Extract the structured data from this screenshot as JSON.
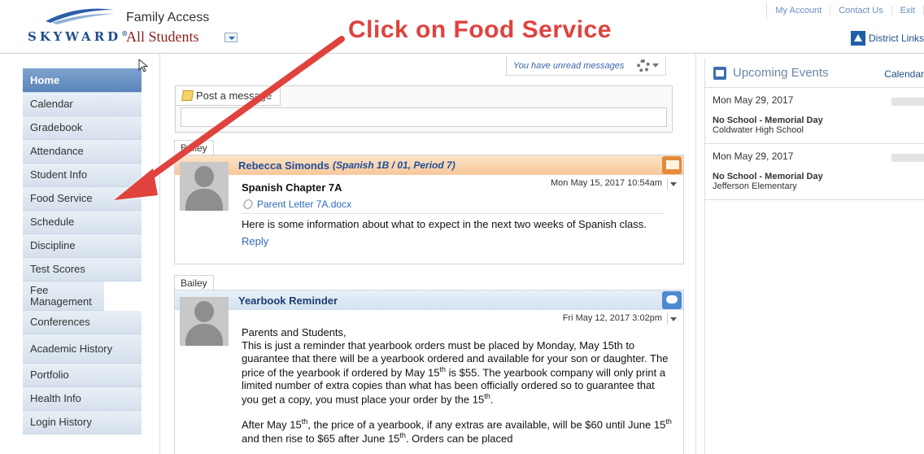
{
  "header": {
    "logo_text": "SKYWARD",
    "logo_mark": "®",
    "title": "Family Access",
    "student_selector": "All Students",
    "top_links": [
      "My Account",
      "Contact Us",
      "Exit"
    ],
    "district_links": "District Links"
  },
  "annotation": {
    "callout": "Click on Food Service"
  },
  "sidebar": {
    "items": [
      {
        "label": "Home"
      },
      {
        "label": "Calendar"
      },
      {
        "label": "Gradebook"
      },
      {
        "label": "Attendance"
      },
      {
        "label": "Student Info"
      },
      {
        "label": "Food Service"
      },
      {
        "label": "Schedule"
      },
      {
        "label": "Discipline"
      },
      {
        "label": "Test Scores"
      },
      {
        "label": "Fee Management"
      },
      {
        "label": "Conferences"
      },
      {
        "label": "Academic History"
      },
      {
        "label": "Portfolio"
      },
      {
        "label": "Health Info"
      },
      {
        "label": "Login History"
      }
    ]
  },
  "main": {
    "unread": "You have unread messages",
    "post_label": "Post a message",
    "messages": [
      {
        "tab": "Bailey",
        "sender": "Rebecca Simonds",
        "course": "(Spanish 1B / 01, Period 7)",
        "date": "Mon May 15, 2017 10:54am",
        "subject": "Spanish Chapter 7A",
        "attachment": "Parent Letter 7A.docx",
        "body": "Here is some information about what to expect in the next two weeks of Spanish class.",
        "reply": "Reply"
      },
      {
        "tab": "Bailey",
        "sender": "Yearbook Reminder",
        "date": "Fri May 12, 2017 3:02pm",
        "greeting": "Parents and Students,",
        "body_1": "This is just a reminder that yearbook orders must be placed by Monday, May 15th to guarantee that there will be a yearbook ordered and available for your son or daughter.  The price of the yearbook if ordered by May 15",
        "sup_th": "th",
        "body_2": " is $55.  The yearbook company will only print a limited number of extra copies than what has been officially ordered so to guarantee that you get a copy, you must place your order by the 15",
        "body_3": ".",
        "body_4": "After May 15",
        "body_5": ", the price of a yearbook, if any extras are available, will be $60 until June 15",
        "body_6": " and then rise to $65 after June 15",
        "body_7": ". Orders can be placed"
      }
    ]
  },
  "events": {
    "title": "Upcoming Events",
    "calendar_link": "Calendar",
    "items": [
      {
        "date": "Mon May 29, 2017",
        "name": "No School - Memorial Day",
        "school": "Coldwater High School"
      },
      {
        "date": "Mon May 29, 2017",
        "name": "No School - Memorial Day",
        "school": "Jefferson Elementary"
      }
    ]
  },
  "colors": {
    "accent_red": "#e0423e",
    "brand_blue": "#1f4e8c",
    "home_nav": "#6a92c6"
  }
}
